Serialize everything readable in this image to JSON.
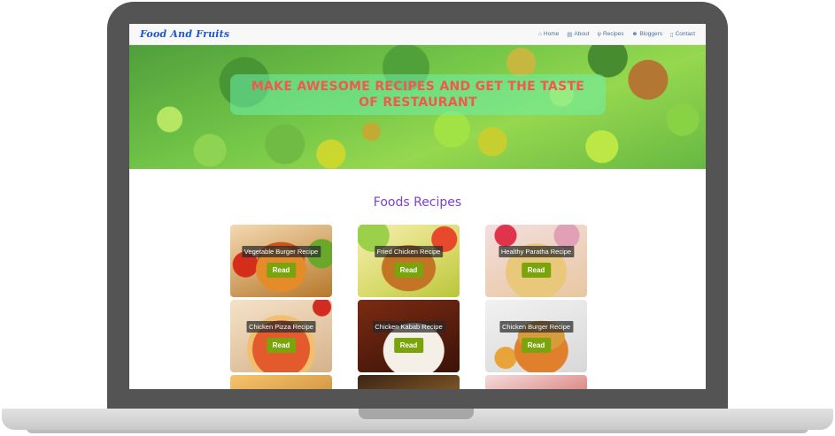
{
  "brand": "Food And Fruits",
  "nav": [
    {
      "icon": "home-icon",
      "glyph": "⌂",
      "label": "Home"
    },
    {
      "icon": "book-icon",
      "glyph": "▤",
      "label": "About"
    },
    {
      "icon": "cutlery-icon",
      "glyph": "ψ",
      "label": "Recipes"
    },
    {
      "icon": "users-icon",
      "glyph": "☻",
      "label": "Bloggers"
    },
    {
      "icon": "phone-icon",
      "glyph": "▯",
      "label": "Contact"
    }
  ],
  "hero": {
    "title": "MAKE AWESOME RECIPES AND GET THE TASTE OF RESTAURANT"
  },
  "section": {
    "title": "Foods Recipes"
  },
  "cards": [
    {
      "label": "Vegetable Burger Recipe",
      "button": "Read"
    },
    {
      "label": "Fried Chicken Recipe",
      "button": "Read"
    },
    {
      "label": "Healthy Paratha Recipe",
      "button": "Read"
    },
    {
      "label": "Chicken Pizza Recipe",
      "button": "Read"
    },
    {
      "label": "Chicken Kabab Recipe",
      "button": "Read"
    },
    {
      "label": "Chicken Burger Recipe",
      "button": "Read"
    }
  ],
  "colors": {
    "brand": "#1f57c9",
    "hero_title": "#ef5a4f",
    "section_title": "#7e3fd0",
    "read_button": "#7aa30c"
  }
}
